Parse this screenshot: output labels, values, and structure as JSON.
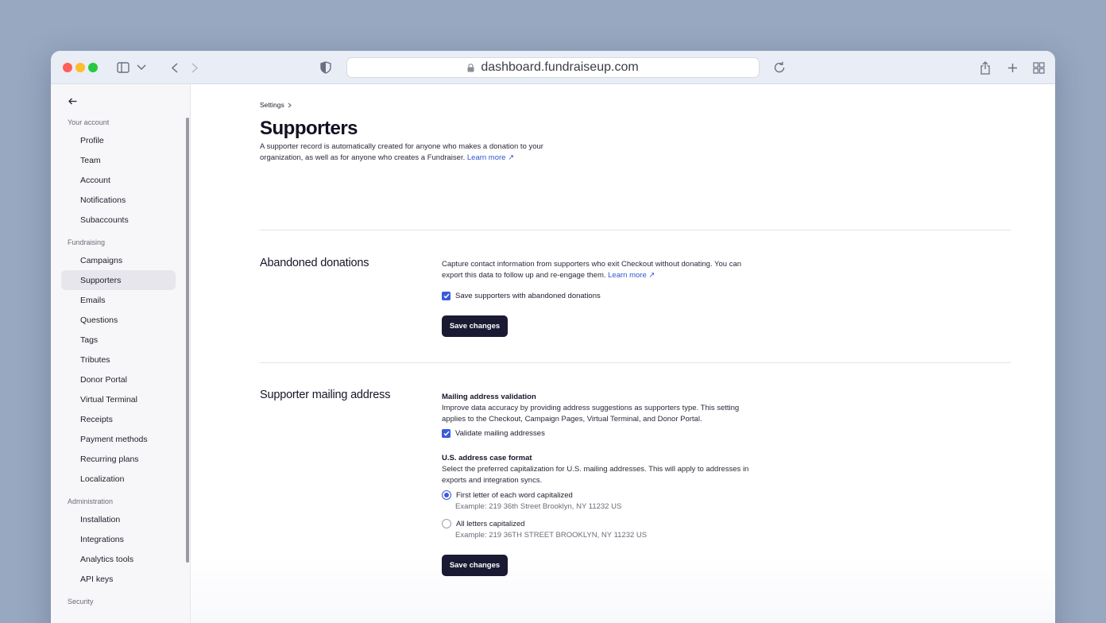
{
  "browser": {
    "url": "dashboard.fundraiseup.com",
    "icons": [
      "close-light",
      "minimize-light",
      "zoom-light",
      "sidebar-icon",
      "chevron-down-icon",
      "back-icon",
      "forward-icon",
      "shield-icon",
      "lock-icon",
      "reload-icon",
      "share-icon",
      "new-tab-icon",
      "tab-overview-icon"
    ],
    "light_colors": {
      "close": "#fe5f57",
      "minimize": "#febc2e",
      "zoom": "#28c840"
    }
  },
  "sidebar": {
    "sections": [
      {
        "label": "Your account"
      },
      {
        "label": "Fundraising"
      },
      {
        "label": "Administration"
      },
      {
        "label": "Security"
      }
    ],
    "account_items": [
      "Profile",
      "Team",
      "Account",
      "Notifications",
      "Subaccounts"
    ],
    "fundraising_items": [
      "Campaigns",
      "Supporters",
      "Emails",
      "Questions",
      "Tags",
      "Tributes",
      "Donor Portal",
      "Virtual Terminal",
      "Receipts",
      "Payment methods",
      "Recurring plans",
      "Localization"
    ],
    "admin_items": [
      "Installation",
      "Integrations",
      "Analytics tools",
      "API keys"
    ],
    "active_item": "Supporters"
  },
  "main": {
    "breadcrumb": "Settings",
    "title": "Supporters",
    "intro_text": "A supporter record is automatically created for anyone who makes a donation to your organization, as well as for anyone who creates a Fundraiser.",
    "learn_more": "Learn more ↗",
    "abandoned": {
      "title": "Abandoned donations",
      "description": "Capture contact information from supporters who exit Checkout without donating. You can export this data to follow up and re-engage them.",
      "learn_more": "Learn more ↗",
      "checkbox_label": "Save supporters with abandoned donations",
      "checked": true,
      "save_label": "Save changes"
    },
    "mailing": {
      "title": "Supporter mailing address",
      "validation_heading": "Mailing address validation",
      "validation_description": "Improve data accuracy by providing address suggestions as supporters type. This setting applies to the Checkout, Campaign Pages, Virtual Terminal, and Donor Portal.",
      "validate_label": "Validate mailing addresses",
      "validate_checked": true,
      "case_heading": "U.S. address case format",
      "case_description": "Select the preferred capitalization for U.S. mailing addresses. This will apply to addresses in exports and integration syncs.",
      "options": [
        {
          "label": "First letter of each word capitalized",
          "example": "Example: 219 36th Street Brooklyn, NY 11232 US",
          "selected": true
        },
        {
          "label": "All letters capitalized",
          "example": "Example: 219 36TH STREET BROOKLYN, NY 11232 US",
          "selected": false
        }
      ],
      "save_label": "Save changes"
    }
  },
  "colors": {
    "accent": "#3b5bdb",
    "button": "#1b1a33",
    "link": "#2f55d4"
  }
}
